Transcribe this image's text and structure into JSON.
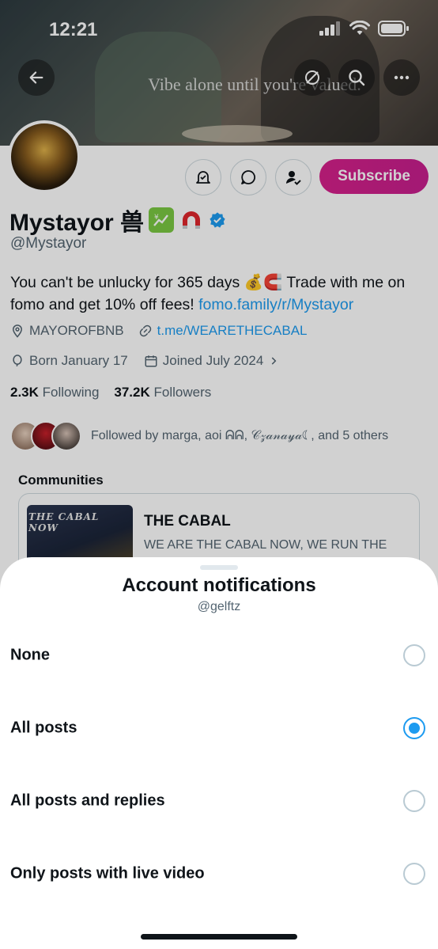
{
  "status_bar": {
    "time": "12:21"
  },
  "banner": {
    "text": "Vibe alone until you're valued."
  },
  "header_icons": {
    "back": "back-arrow-icon",
    "edit": "slash-circle-icon",
    "search": "search-icon",
    "more": "more-icon"
  },
  "actions": {
    "subscribe_label": "Subscribe"
  },
  "profile": {
    "display_name": "Mystayor 兽",
    "handle": "@Mystayor",
    "bio_text": "You can't be unlucky for 365 days 💰🧲 Trade with me on fomo and get 10% off fees! ",
    "bio_link": "fomo.family/r/Mystayor",
    "location": "MAYOROFBNB",
    "website": "t.me/WEARETHECABAL",
    "birthday": "Born January 17",
    "joined": "Joined July 2024",
    "following_count": "2.3K",
    "following_label": "Following",
    "followers_count": "37.2K",
    "followers_label": "Followers",
    "followed_by": "Followed by marga, aoi ᕱᕱ, 𝒞𝓏𝒶𝓃𝒶𝓎𝒶☾, and 5 others"
  },
  "communities": {
    "title": "Communities",
    "card_image_text": "THE CABAL NOW",
    "name": "THE CABAL",
    "description": "WE ARE THE CABAL NOW, WE RUN THE TRENCHES"
  },
  "sheet": {
    "title": "Account notifications",
    "subtitle": "@gelftz",
    "options": [
      {
        "label": "None",
        "selected": false
      },
      {
        "label": "All posts",
        "selected": true
      },
      {
        "label": "All posts and replies",
        "selected": false
      },
      {
        "label": "Only posts with live video",
        "selected": false
      }
    ]
  },
  "colors": {
    "accent": "#1d9bf0",
    "subscribe": "#d6208a",
    "text_primary": "#0f1419",
    "text_secondary": "#536471"
  }
}
